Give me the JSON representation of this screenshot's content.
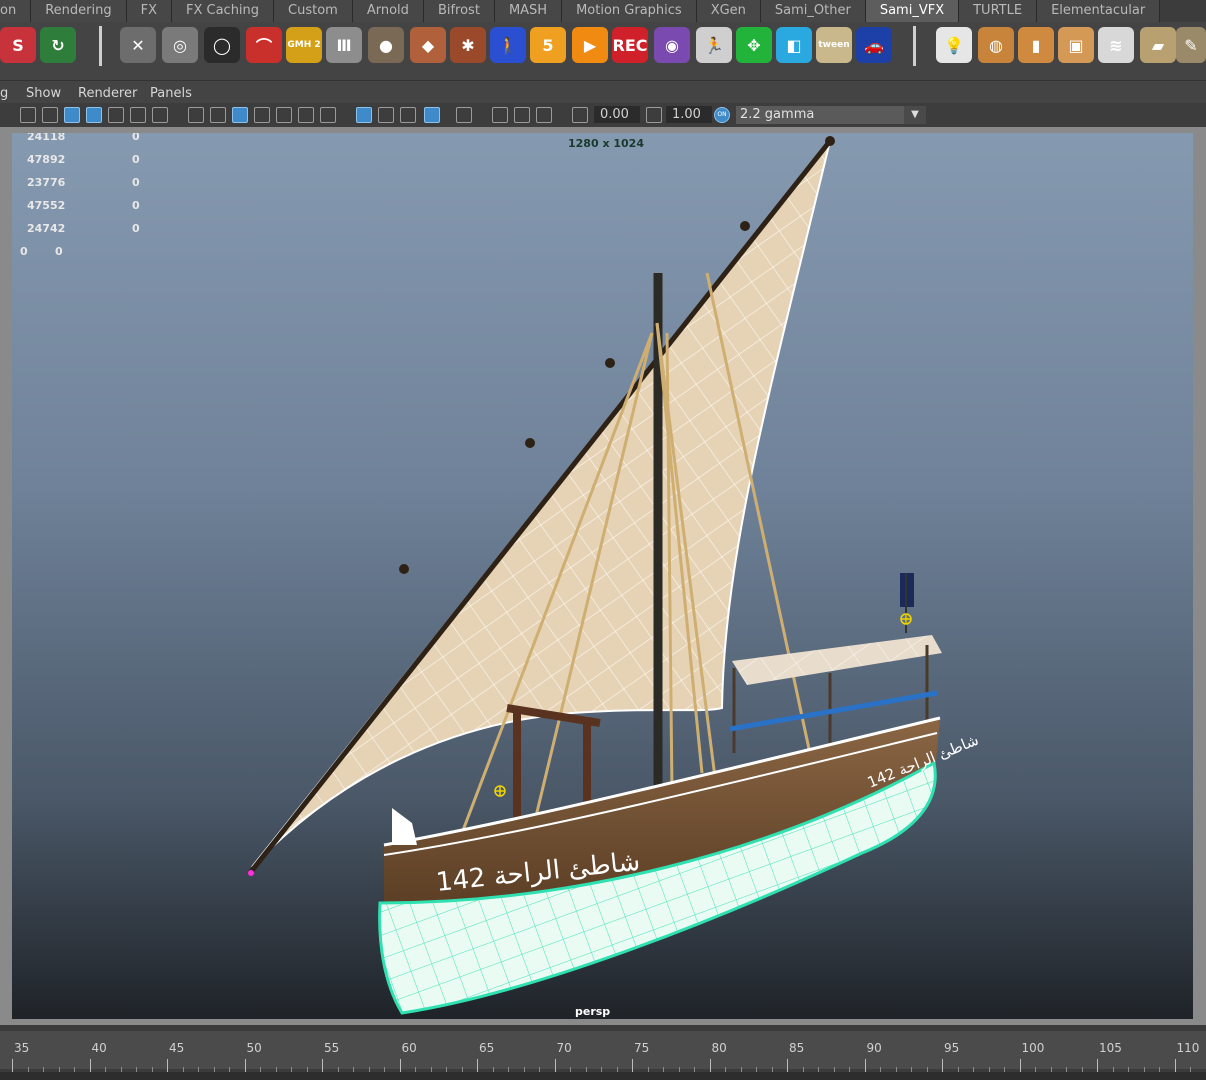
{
  "shelf_tabs": [
    {
      "label": "on"
    },
    {
      "label": "Rendering"
    },
    {
      "label": "FX"
    },
    {
      "label": "FX Caching"
    },
    {
      "label": "Custom"
    },
    {
      "label": "Arnold"
    },
    {
      "label": "Bifrost"
    },
    {
      "label": "MASH"
    },
    {
      "label": "Motion Graphics"
    },
    {
      "label": "XGen"
    },
    {
      "label": "Sami_Other"
    },
    {
      "label": "Sami_VFX"
    },
    {
      "label": "TURTLE"
    },
    {
      "label": "Elementacular"
    }
  ],
  "active_tab": "Sami_VFX",
  "shelf_icons": [
    {
      "name": "substance-icon",
      "label": "S"
    },
    {
      "name": "refresh-icon",
      "label": "↻"
    },
    {
      "name": "tools-icon",
      "label": "✕"
    },
    {
      "name": "ring-icon",
      "label": "◎"
    },
    {
      "name": "torus-icon",
      "label": "◯"
    },
    {
      "name": "boomerang-icon",
      "label": "⌒"
    },
    {
      "name": "gmh2-icon",
      "label": "GMH 2"
    },
    {
      "name": "column-icon",
      "label": "Ⅲ"
    },
    {
      "name": "rock-icon",
      "label": "●"
    },
    {
      "name": "crate-icon",
      "label": "◆"
    },
    {
      "name": "shatter-icon",
      "label": "✱"
    },
    {
      "name": "walker-icon",
      "label": "🚶"
    },
    {
      "name": "five-icon",
      "label": "5"
    },
    {
      "name": "play-icon",
      "label": "▶"
    },
    {
      "name": "rec-icon",
      "label": "REC"
    },
    {
      "name": "brain-icon",
      "label": "◉"
    },
    {
      "name": "stickman-icon",
      "label": "🏃"
    },
    {
      "name": "move-arrows-icon",
      "label": "✥"
    },
    {
      "name": "cube-blue-icon",
      "label": "◧"
    },
    {
      "name": "tween-icon",
      "label": "tween"
    },
    {
      "name": "car-icon",
      "label": "🚗"
    },
    {
      "name": "lightbulb-icon",
      "label": "💡"
    },
    {
      "name": "sphere-grid-icon",
      "label": "◍"
    },
    {
      "name": "bone-icon",
      "label": "▮"
    },
    {
      "name": "box-icon",
      "label": "▣"
    },
    {
      "name": "layers-icon",
      "label": "≋"
    },
    {
      "name": "paint-icon",
      "label": "▰"
    },
    {
      "name": "edit-icon",
      "label": "✎"
    }
  ],
  "panel_menu": [
    "g",
    "Show",
    "Renderer",
    "Panels"
  ],
  "panel_toolbar": {
    "field1": "0.00",
    "field2": "1.00",
    "gamma": "2.2 gamma",
    "on_label": "ON"
  },
  "viewport": {
    "resolution": "1280 x 1024",
    "camera": "persp",
    "stats": [
      {
        "a": "24118",
        "b": "0"
      },
      {
        "a": "47892",
        "b": "0"
      },
      {
        "a": "23776",
        "b": "0"
      },
      {
        "a": "47552",
        "b": "0"
      },
      {
        "a": "24742",
        "b": "0"
      },
      {
        "a": "0",
        "b": "0"
      }
    ],
    "hull_text": "142 شاطئ الراحة",
    "hull_text_side": "142 شاطئ الراحة"
  },
  "timeline": {
    "labels": [
      "35",
      "40",
      "45",
      "50",
      "55",
      "60",
      "65",
      "70",
      "75",
      "80",
      "85",
      "90",
      "95",
      "100",
      "105",
      "110"
    ]
  },
  "colors": {
    "sail": "#e6d3b5",
    "hull_wood": "#6b4a2f",
    "hull_bottom": "#e9fbf4",
    "wire_green": "#2fe0b0",
    "active_tab": "#5d5d5d"
  }
}
